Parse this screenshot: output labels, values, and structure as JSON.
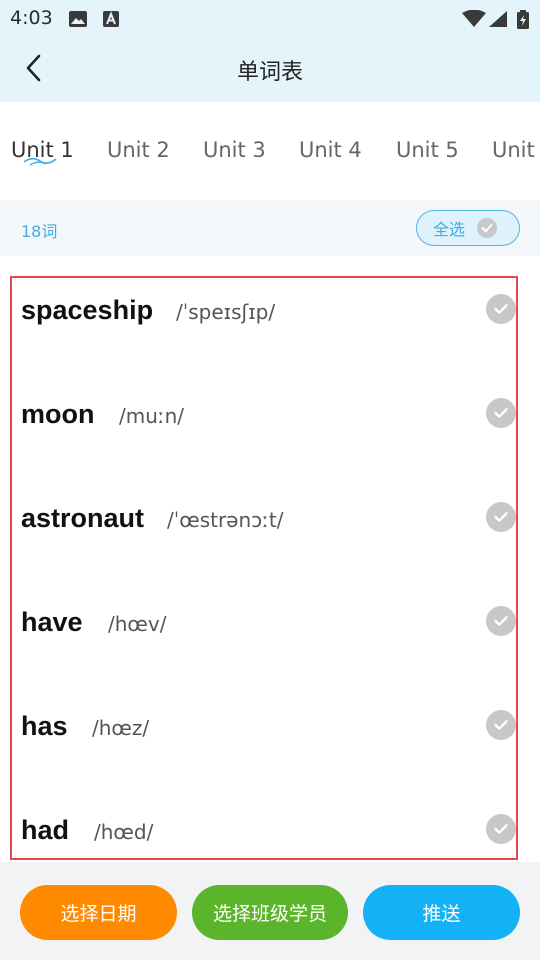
{
  "status_bar": {
    "time": "4:03",
    "icons": [
      "image-icon",
      "text-a-icon",
      "wifi-icon",
      "signal-icon",
      "battery-icon"
    ]
  },
  "header": {
    "title": "单词表",
    "back_icon": "chevron-left-icon"
  },
  "tabs": [
    {
      "label": "Unit 1",
      "active": true
    },
    {
      "label": "Unit 2",
      "active": false
    },
    {
      "label": "Unit 3",
      "active": false
    },
    {
      "label": "Unit 4",
      "active": false
    },
    {
      "label": "Unit 5",
      "active": false
    },
    {
      "label": "Unit",
      "active": false
    }
  ],
  "word_count": "18词",
  "select_all": {
    "label": "全选",
    "icon": "check-circle-icon"
  },
  "words": [
    {
      "word": "spaceship",
      "phonetic": "/ˈspeɪsʃɪp/"
    },
    {
      "word": "moon",
      "phonetic": "/muːn/"
    },
    {
      "word": "astronaut",
      "phonetic": "/ˈœstrənɔːt/"
    },
    {
      "word": "have",
      "phonetic": "/hœv/"
    },
    {
      "word": "has",
      "phonetic": "/hœz/"
    },
    {
      "word": "had",
      "phonetic": "/hœd/"
    }
  ],
  "buttons": {
    "choose_date": "选择日期",
    "choose_students": "选择班级学员",
    "push": "推送"
  },
  "colors": {
    "header_bg": "#e3f4fb",
    "accent_blue": "#3eaee0",
    "orange": "#ff8a00",
    "green": "#5ab52a",
    "blue": "#13b1f5",
    "selection_border": "#e04a4a"
  }
}
